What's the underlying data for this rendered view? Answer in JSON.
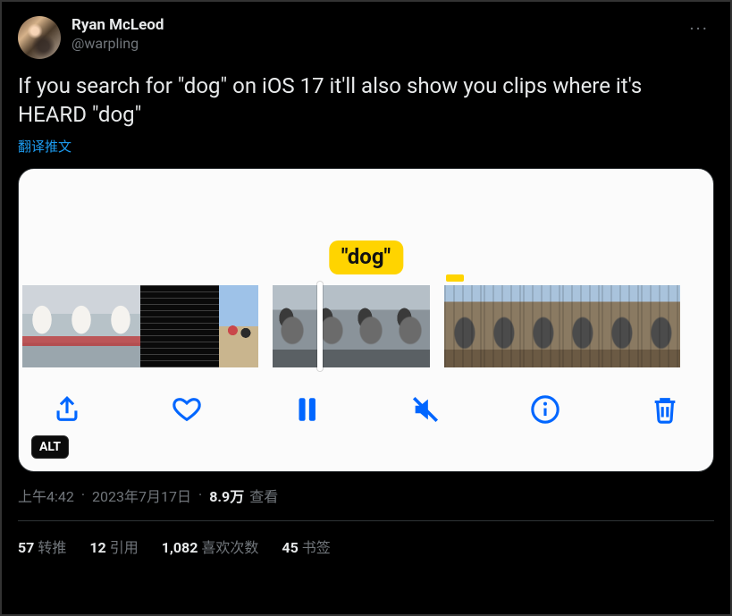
{
  "author": {
    "display_name": "Ryan McLeod",
    "handle": "@warpling"
  },
  "more_glyph": "···",
  "body_text": "If you search for \"dog\" on iOS 17 it'll also show you clips where it's HEARD \"dog\"",
  "translate_label": "翻译推文",
  "media": {
    "highlight_label": "\"dog\"",
    "alt_badge": "ALT",
    "toolbar": {
      "share": "share-icon",
      "like": "heart-icon",
      "pause": "pause-icon",
      "mute": "speaker-muted-icon",
      "info": "info-icon",
      "trash": "trash-icon"
    }
  },
  "meta": {
    "time": "上午4:42",
    "date": "2023年7月17日",
    "views_number": "8.9万",
    "views_label": "查看"
  },
  "stats": {
    "retweets": {
      "count": "57",
      "label": "转推"
    },
    "quotes": {
      "count": "12",
      "label": "引用"
    },
    "likes": {
      "count": "1,082",
      "label": "喜欢次数"
    },
    "bookmarks": {
      "count": "45",
      "label": "书签"
    }
  }
}
